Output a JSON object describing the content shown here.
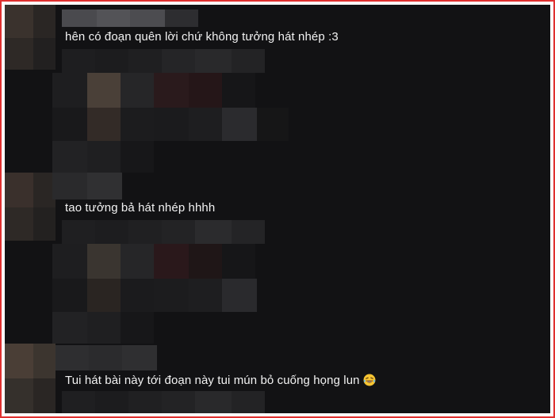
{
  "comments": [
    {
      "text": "hên có đoạn quên lời chứ không tưởng hát nhép :3"
    },
    {
      "text": "tao tưởng bả hát nhép hhhh"
    },
    {
      "text": "Tui hát bài này tới đoạn này tui mún bỏ cuống họng lun",
      "emoji": "laughing-tears-emoji"
    }
  ],
  "colors": {
    "background": "#121214",
    "text": "#f2f2f2",
    "border": "#e0302f"
  }
}
